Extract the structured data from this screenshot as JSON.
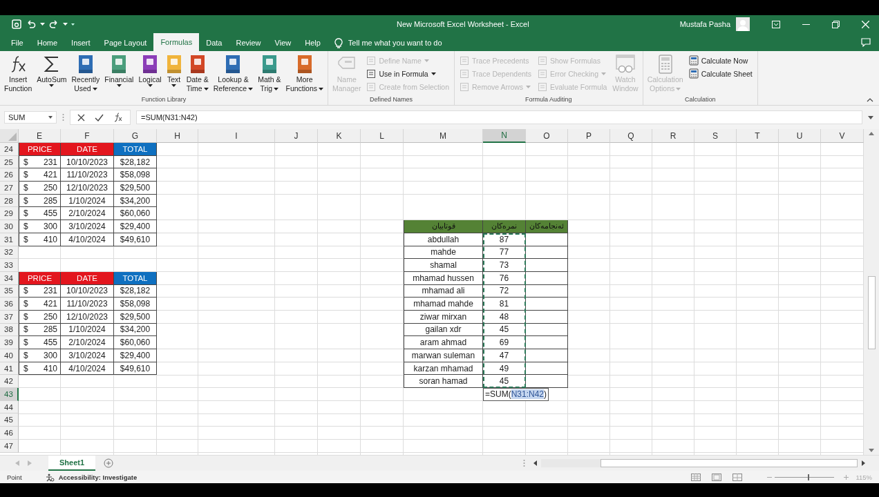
{
  "window": {
    "title": "New Microsoft Excel Worksheet  -  Excel",
    "user": "Mustafa Pasha"
  },
  "tabs": [
    {
      "label": "File",
      "selected": false
    },
    {
      "label": "Home",
      "selected": false
    },
    {
      "label": "Insert",
      "selected": false
    },
    {
      "label": "Page Layout",
      "selected": false
    },
    {
      "label": "Formulas",
      "selected": true
    },
    {
      "label": "Data",
      "selected": false
    },
    {
      "label": "Review",
      "selected": false
    },
    {
      "label": "View",
      "selected": false
    },
    {
      "label": "Help",
      "selected": false
    }
  ],
  "tell_me": {
    "placeholder": "Tell me what you want to do"
  },
  "ribbon_groups": [
    {
      "name": "Function Library",
      "buttons": [
        {
          "kind": "large",
          "lines": [
            "Insert",
            "Function"
          ],
          "dropdown": false,
          "disabled": false
        },
        {
          "kind": "large",
          "lines": [
            "AutoSum"
          ],
          "dropdown": true,
          "disabled": false
        },
        {
          "kind": "large",
          "lines": [
            "Recently",
            "Used"
          ],
          "dropdown": true,
          "disabled": false
        },
        {
          "kind": "large",
          "lines": [
            "Financial"
          ],
          "dropdown": true,
          "disabled": false
        },
        {
          "kind": "large",
          "lines": [
            "Logical"
          ],
          "dropdown": true,
          "disabled": false
        },
        {
          "kind": "large",
          "lines": [
            "Text"
          ],
          "dropdown": true,
          "disabled": false
        },
        {
          "kind": "large",
          "lines": [
            "Date &",
            "Time"
          ],
          "dropdown": true,
          "disabled": false
        },
        {
          "kind": "large",
          "lines": [
            "Lookup &",
            "Reference"
          ],
          "dropdown": true,
          "disabled": false
        },
        {
          "kind": "large",
          "lines": [
            "Math &",
            "Trig"
          ],
          "dropdown": true,
          "disabled": false
        },
        {
          "kind": "large",
          "lines": [
            "More",
            "Functions"
          ],
          "dropdown": true,
          "disabled": false
        }
      ]
    },
    {
      "name": "Defined Names",
      "buttons": [
        {
          "kind": "large",
          "lines": [
            "Name",
            "Manager"
          ],
          "dropdown": false,
          "disabled": true
        },
        {
          "kind": "small",
          "lines": [
            "Define Name"
          ],
          "dropdown": true,
          "disabled": true
        },
        {
          "kind": "small",
          "lines": [
            "Use in Formula"
          ],
          "dropdown": true,
          "disabled": false
        },
        {
          "kind": "small",
          "lines": [
            "Create from Selection"
          ],
          "dropdown": false,
          "disabled": true
        }
      ]
    },
    {
      "name": "Formula Auditing",
      "buttons": [
        {
          "kind": "small",
          "lines": [
            "Trace Precedents"
          ],
          "dropdown": false,
          "disabled": true
        },
        {
          "kind": "small",
          "lines": [
            "Trace Dependents"
          ],
          "dropdown": false,
          "disabled": true
        },
        {
          "kind": "small",
          "lines": [
            "Remove Arrows"
          ],
          "dropdown": true,
          "disabled": true
        },
        {
          "kind": "small",
          "lines": [
            "Show Formulas"
          ],
          "dropdown": false,
          "disabled": true
        },
        {
          "kind": "small",
          "lines": [
            "Error Checking"
          ],
          "dropdown": true,
          "disabled": true
        },
        {
          "kind": "small",
          "lines": [
            "Evaluate Formula"
          ],
          "dropdown": false,
          "disabled": true
        },
        {
          "kind": "large",
          "lines": [
            "Watch",
            "Window"
          ],
          "dropdown": false,
          "disabled": true
        }
      ]
    },
    {
      "name": "Calculation",
      "buttons": [
        {
          "kind": "large",
          "lines": [
            "Calculation",
            "Options"
          ],
          "dropdown": true,
          "disabled": true
        },
        {
          "kind": "small",
          "lines": [
            "Calculate Now"
          ],
          "dropdown": false,
          "disabled": false
        },
        {
          "kind": "small",
          "lines": [
            "Calculate Sheet"
          ],
          "dropdown": false,
          "disabled": false
        }
      ]
    }
  ],
  "formula_bar": {
    "name_box": "SUM",
    "formula": "=SUM(N31:N42)"
  },
  "columns": [
    "E",
    "F",
    "G",
    "H",
    "I",
    "J",
    "K",
    "L",
    "M",
    "N",
    "O",
    "P",
    "Q",
    "R",
    "S",
    "T",
    "U",
    "V"
  ],
  "rows": [
    "24",
    "25",
    "26",
    "27",
    "28",
    "29",
    "30",
    "31",
    "32",
    "33",
    "34",
    "35",
    "36",
    "37",
    "38",
    "39",
    "40",
    "41",
    "42",
    "43",
    "44",
    "45",
    "46",
    "47"
  ],
  "price_tables": [
    {
      "headers": [
        {
          "text": "PRICE",
          "color": "#e3161e"
        },
        {
          "text": "DATE",
          "color": "#e3161e"
        },
        {
          "text": "TOTAL",
          "color": "#0f70c0"
        }
      ],
      "rows": [
        {
          "symbol": "$",
          "price": "231",
          "date": "10/10/2023",
          "total": "$28,182"
        },
        {
          "symbol": "$",
          "price": "421",
          "date": "11/10/2023",
          "total": "$58,098"
        },
        {
          "symbol": "$",
          "price": "250",
          "date": "12/10/2023",
          "total": "$29,500"
        },
        {
          "symbol": "$",
          "price": "285",
          "date": "1/10/2024",
          "total": "$34,200"
        },
        {
          "symbol": "$",
          "price": "455",
          "date": "2/10/2024",
          "total": "$60,060"
        },
        {
          "symbol": "$",
          "price": "300",
          "date": "3/10/2024",
          "total": "$29,400"
        },
        {
          "symbol": "$",
          "price": "410",
          "date": "4/10/2024",
          "total": "$49,610"
        }
      ]
    },
    {
      "headers": [
        {
          "text": "PRICE",
          "color": "#e3161e"
        },
        {
          "text": "DATE",
          "color": "#e3161e"
        },
        {
          "text": "TOTAL",
          "color": "#0f70c0"
        }
      ],
      "rows": [
        {
          "symbol": "$",
          "price": "231",
          "date": "10/10/2023",
          "total": "$28,182"
        },
        {
          "symbol": "$",
          "price": "421",
          "date": "11/10/2023",
          "total": "$58,098"
        },
        {
          "symbol": "$",
          "price": "250",
          "date": "12/10/2023",
          "total": "$29,500"
        },
        {
          "symbol": "$",
          "price": "285",
          "date": "1/10/2024",
          "total": "$34,200"
        },
        {
          "symbol": "$",
          "price": "455",
          "date": "2/10/2024",
          "total": "$60,060"
        },
        {
          "symbol": "$",
          "price": "300",
          "date": "3/10/2024",
          "total": "$29,400"
        },
        {
          "symbol": "$",
          "price": "410",
          "date": "4/10/2024",
          "total": "$49,610"
        }
      ]
    }
  ],
  "students_table": {
    "headers": {
      "name": "قوتابیان",
      "score": "نمرەکان",
      "result": "ئەنجامەکان"
    },
    "rows": [
      {
        "name": "abdullah",
        "score": "87"
      },
      {
        "name": "mahde",
        "score": "77"
      },
      {
        "name": "shamal",
        "score": "73"
      },
      {
        "name": "mhamad hussen",
        "score": "76"
      },
      {
        "name": "mhamad ali",
        "score": "72"
      },
      {
        "name": "mhamad mahde",
        "score": "81"
      },
      {
        "name": "ziwar mirxan",
        "score": "48"
      },
      {
        "name": "gailan xdr",
        "score": "45"
      },
      {
        "name": "aram ahmad",
        "score": "69"
      },
      {
        "name": "marwan suleman",
        "score": "47"
      },
      {
        "name": "karzan mhamad",
        "score": "49"
      },
      {
        "name": "soran hamad",
        "score": "45"
      }
    ]
  },
  "cell_editor": {
    "prefix": "=SUM(",
    "reference": "N31:N42",
    "suffix": ")"
  },
  "sheet_tabs": [
    {
      "label": "Sheet1",
      "selected": true
    }
  ],
  "status_bar": {
    "mode": "Point",
    "accessibility": "Accessibility: Investigate",
    "zoom": "115%",
    "zoom_slider": {
      "level": 0.55
    }
  }
}
